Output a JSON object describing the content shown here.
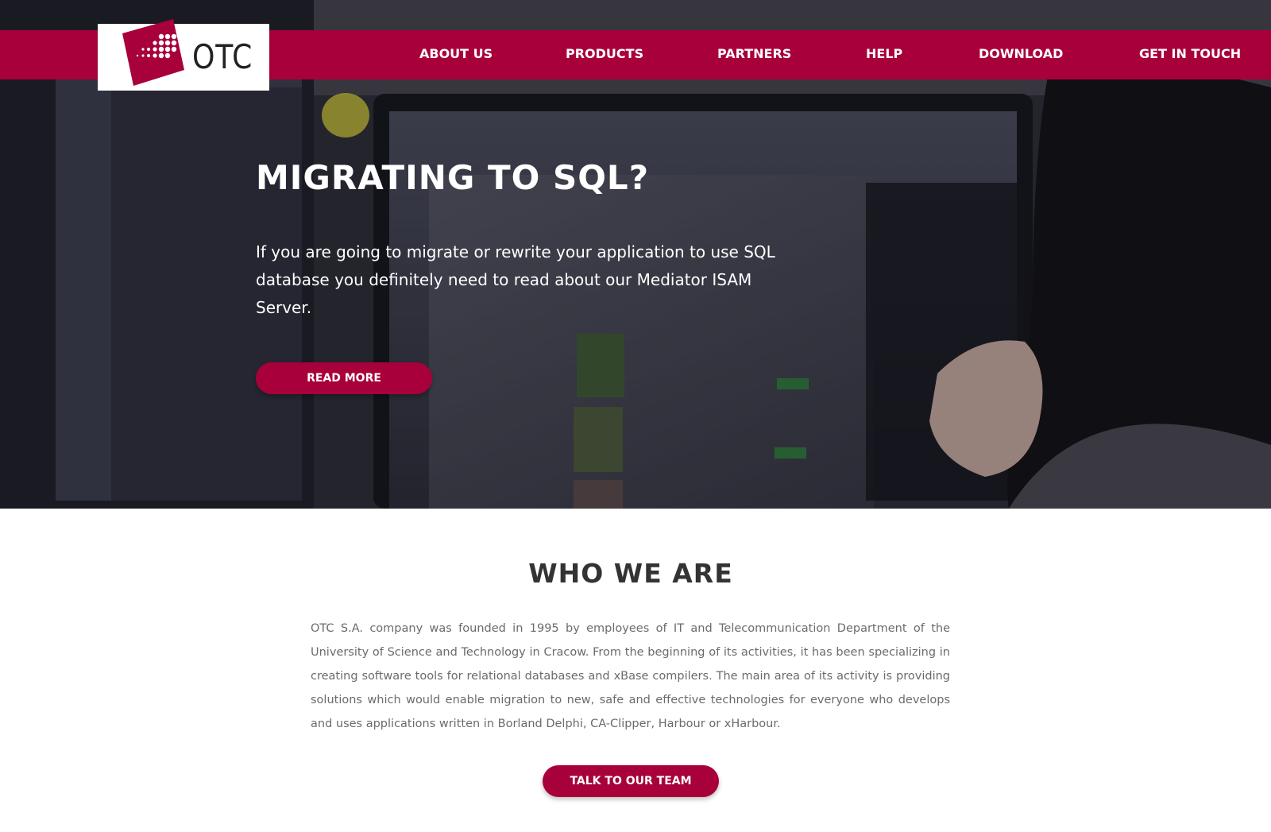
{
  "brand": {
    "name": "OTC",
    "accent": "#a8003a"
  },
  "nav": {
    "items": [
      {
        "label": "ABOUT US"
      },
      {
        "label": "PRODUCTS"
      },
      {
        "label": "PARTNERS"
      },
      {
        "label": "HELP"
      },
      {
        "label": "DOWNLOAD"
      },
      {
        "label": "GET IN TOUCH"
      }
    ]
  },
  "hero": {
    "title": "MIGRATING TO SQL?",
    "text": "If you are going to migrate or rewrite your application to use SQL database you definitely need to read about our Mediator ISAM Server.",
    "button": "READ MORE",
    "background": "photo-person-at-computer-monitors"
  },
  "about": {
    "title": "WHO WE ARE",
    "text": "OTC S.A. company was founded in 1995 by employees of IT and Telecommunication Department of the University of Science and Technology in Cracow. From the beginning of its activities, it has been specializing in creating software tools for relational databases and xBase compilers. The main area of its activity is providing solutions which would enable migration to new, safe and effective technologies for everyone who develops and uses applications written in Borland Delphi, CA-Clipper, Harbour or xHarbour.",
    "button": "TALK TO OUR TEAM"
  }
}
